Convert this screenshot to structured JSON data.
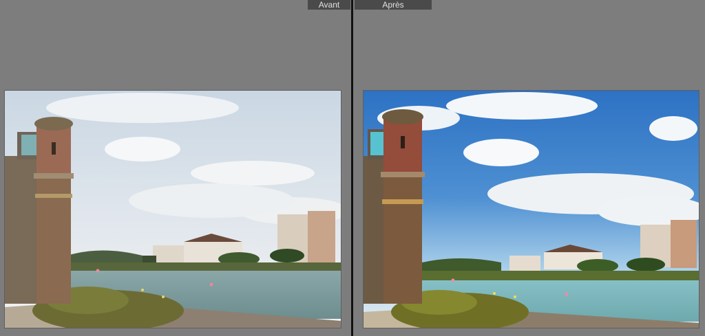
{
  "compare": {
    "before_label": "Avant",
    "after_label": "Après"
  },
  "photos": {
    "before": {
      "icon": "photo-before-icon",
      "sky_top": "#cfdbe6",
      "sky_bottom": "#eef1f4",
      "water": "#7fa0a3"
    },
    "after": {
      "icon": "photo-after-icon",
      "sky_top": "#2f78c8",
      "sky_bottom": "#9ccbe8",
      "water": "#7fb8bf"
    }
  },
  "colors": {
    "background": "#7d7d7d",
    "label_bg": "#4a4a4a",
    "divider": "#111111"
  }
}
